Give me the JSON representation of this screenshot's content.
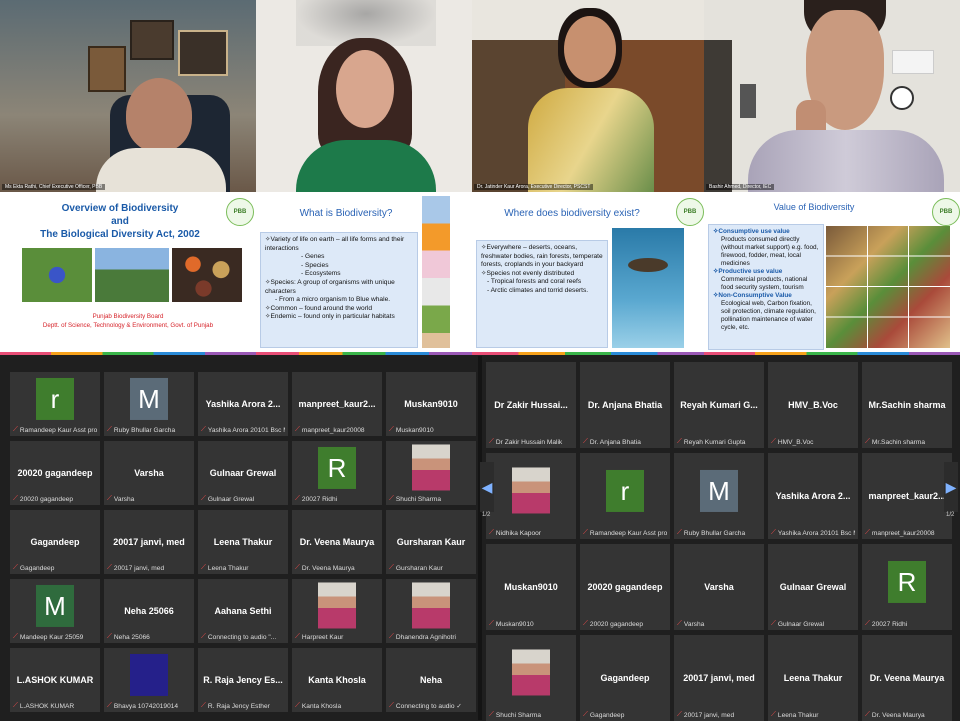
{
  "videos": [
    {
      "name": "Ms Ekta Rathi, Chief Executive Officer, PBB"
    },
    {
      "name": ""
    },
    {
      "name": "Dr. Jatinder Kaur Arora, Executive Director, PSCST"
    },
    {
      "name": "Bashir Ahmed, Director, IEC"
    }
  ],
  "slides": {
    "s1": {
      "title1": "Overview of Biodiversity",
      "title2": "and",
      "title3": "The Biological Diversity Act, 2002",
      "footer1": "Punjab Biodiversity Board",
      "footer2": "Deptt. of Science, Technology & Environment, Govt. of Punjab",
      "logo": "PBB"
    },
    "s2": {
      "title": "What is Biodiversity?",
      "lines": [
        "✧Variety of life on earth – all life forms and their interactions",
        "- Genes",
        "- Species",
        "- Ecosystems",
        "✧Species: A group of organisms with unique characters",
        "- From a micro organism to Blue whale.",
        "✧Common – found around the world",
        "✧Endemic – found only in particular  habitats"
      ]
    },
    "s3": {
      "title": "Where does biodiversity exist?",
      "lines": [
        "✧Everywhere – deserts, oceans, freshwater bodies, rain forests, temperate forests, croplands in your backyard",
        "✧Species not evenly distributed",
        "- Tropical forests and coral reefs",
        "- Arctic climates and torrid deserts."
      ],
      "logo": "PBB"
    },
    "s4": {
      "title": "Value of Biodiversity",
      "h1": "✧Consumptive use value",
      "p1": "Products consumed directly (without market support) e.g. food, firewood, fodder, meat, local medicines",
      "h2": "✧Productive use value",
      "p2": "Commercial products, national food security system, tourism",
      "h3": "✧Non-Consumptive Value",
      "p3": "Ecological web, Carbon fixation, soil protection, climate regulation, pollination maintenance of water cycle, etc.",
      "logo": "PBB"
    }
  },
  "gallery_left": [
    {
      "avatar": "r",
      "color": "#3f7d2d",
      "label": "Ramandeep Kaur Asst prof..."
    },
    {
      "avatar": "M",
      "color": "#5b6b78",
      "label": "Ruby Bhullar Garcha"
    },
    {
      "name": "Yashika Arora 2...",
      "label": "Yashika Arora 20101 Bsc M..."
    },
    {
      "name": "manpreet_kaur2...",
      "label": "manpreet_kaur20008"
    },
    {
      "name": "Muskan9010",
      "label": "Muskan9010"
    },
    {
      "name": "20020 gagandeep",
      "label": "20020 gagandeep"
    },
    {
      "name": "Varsha",
      "label": "Varsha"
    },
    {
      "name": "Gulnaar Grewal",
      "label": "Gulnaar Grewal"
    },
    {
      "avatar": "R",
      "color": "#3f7d2d",
      "label": "20027 Ridhi"
    },
    {
      "photo": true,
      "label": "Shuchi Sharma"
    },
    {
      "name": "Gagandeep",
      "label": "Gagandeep"
    },
    {
      "name": "20017 janvi, med",
      "label": "20017 janvi, med"
    },
    {
      "name": "Leena Thakur",
      "label": "Leena Thakur"
    },
    {
      "name": "Dr. Veena Maurya",
      "label": "Dr. Veena Maurya"
    },
    {
      "name": "Gursharan Kaur",
      "label": "Gursharan Kaur"
    },
    {
      "avatar": "M",
      "color": "#2f6b3d",
      "label": "Mandeep Kaur 25059"
    },
    {
      "name": "Neha 25066",
      "label": "Neha 25066"
    },
    {
      "name": "Aahana Sethi",
      "label": "Connecting to audio \"..."
    },
    {
      "photo": true,
      "label": "Harpreet Kaur"
    },
    {
      "photo": true,
      "label": "Dhanendra Agnihotri"
    },
    {
      "name": "L.ASHOK KUMAR",
      "label": "L.ASHOK KUMAR"
    },
    {
      "avatar": "",
      "color": "#25208a",
      "label": "Bhavya 10742019014"
    },
    {
      "name": "R. Raja Jency Es...",
      "label": "R. Raja Jency Esther"
    },
    {
      "name": "Kanta Khosla",
      "label": "Kanta Khosla"
    },
    {
      "name": "Neha",
      "label": "Connecting to audio ✓"
    }
  ],
  "gallery_right": [
    {
      "name": "Dr Zakir Hussai...",
      "label": "Dr Zakir Hussain Malik"
    },
    {
      "name": "Dr. Anjana Bhatia",
      "label": "Dr. Anjana Bhatia"
    },
    {
      "name": "Reyah Kumari G...",
      "label": "Reyah Kumari Gupta"
    },
    {
      "name": "HMV_B.Voc",
      "label": "HMV_B.Voc"
    },
    {
      "name": "Mr.Sachin sharma",
      "label": "Mr.Sachin sharma"
    },
    {
      "photo": true,
      "label": "Nidhika Kapoor"
    },
    {
      "avatar": "r",
      "color": "#3f7d2d",
      "label": "Ramandeep Kaur Asst prof..."
    },
    {
      "avatar": "M",
      "color": "#5b6b78",
      "label": "Ruby Bhullar Garcha"
    },
    {
      "name": "Yashika Arora 2...",
      "label": "Yashika Arora 20101 Bsc M..."
    },
    {
      "name": "manpreet_kaur2...",
      "label": "manpreet_kaur20008"
    },
    {
      "name": "Muskan9010",
      "label": "Muskan9010"
    },
    {
      "name": "20020 gagandeep",
      "label": "20020 gagandeep"
    },
    {
      "name": "Varsha",
      "label": "Varsha"
    },
    {
      "name": "Gulnaar Grewal",
      "label": "Gulnaar Grewal"
    },
    {
      "avatar": "R",
      "color": "#3f7d2d",
      "label": "20027 Ridhi"
    },
    {
      "photo": true,
      "label": "Shuchi Sharma"
    },
    {
      "name": "Gagandeep",
      "label": "Gagandeep"
    },
    {
      "name": "20017 janvi, med",
      "label": "20017 janvi, med"
    },
    {
      "name": "Leena Thakur",
      "label": "Leena Thakur"
    },
    {
      "name": "Dr. Veena Maurya",
      "label": "Dr. Veena Maurya"
    }
  ],
  "pager": {
    "left": "1/2",
    "right": "1/2"
  },
  "colors": {
    "tile": "#343434",
    "mic_muted": "#ff4d4d",
    "arrow": "#7fb2ff"
  }
}
